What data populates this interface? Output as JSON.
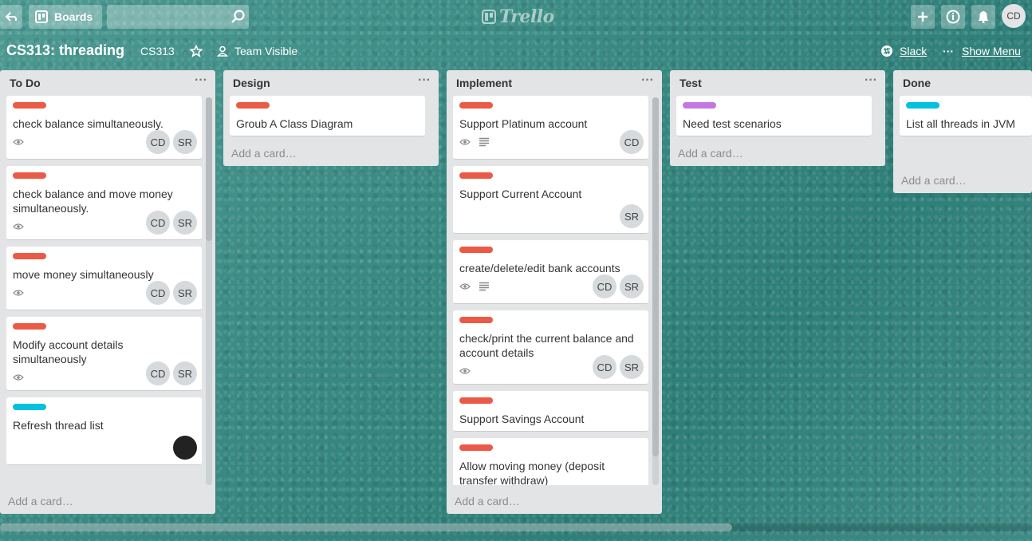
{
  "header": {
    "boards_label": "Boards",
    "logo_text": "Trello",
    "user_initials": "CD"
  },
  "board": {
    "title": "CS313: threading",
    "team": "CS313",
    "visibility": "Team Visible",
    "slack_label": "Slack",
    "show_menu_label": "Show Menu"
  },
  "colors": {
    "red_label": "#eb5a46",
    "teal_label": "#00c2e0",
    "purple_label": "#c377e0"
  },
  "add_card_label": "Add a card…",
  "lists": [
    {
      "title": "To Do",
      "cards": [
        {
          "title": "check balance simultaneously.",
          "label": "#eb5a46",
          "watch": true,
          "desc": false,
          "members": [
            "CD",
            "SR"
          ]
        },
        {
          "title": "check balance and move money simultaneously.",
          "label": "#eb5a46",
          "watch": true,
          "desc": false,
          "members": [
            "CD",
            "SR"
          ]
        },
        {
          "title": "move money simultaneously",
          "label": "#eb5a46",
          "watch": true,
          "desc": false,
          "members": [
            "CD",
            "SR"
          ]
        },
        {
          "title": "Modify account details simultaneously",
          "label": "#eb5a46",
          "watch": true,
          "desc": false,
          "members": [
            "CD",
            "SR"
          ]
        },
        {
          "title": "Refresh thread list",
          "label": "#00c2e0",
          "watch": false,
          "desc": false,
          "members": [
            ""
          ]
        }
      ]
    },
    {
      "title": "Design",
      "cards": [
        {
          "title": "Groub A Class Diagram",
          "label": "#eb5a46",
          "watch": false,
          "desc": false,
          "members": []
        }
      ]
    },
    {
      "title": "Implement",
      "cards": [
        {
          "title": "Support Platinum account",
          "label": "#eb5a46",
          "watch": true,
          "desc": true,
          "members": [
            "CD"
          ]
        },
        {
          "title": "Support Current Account",
          "label": "#eb5a46",
          "watch": false,
          "desc": false,
          "members": [
            "SR"
          ]
        },
        {
          "title": "create/delete/edit bank accounts",
          "label": "#eb5a46",
          "watch": true,
          "desc": true,
          "members": [
            "CD",
            "SR"
          ]
        },
        {
          "title": "check/print the current balance and account details",
          "label": "#eb5a46",
          "watch": true,
          "desc": false,
          "members": [
            "CD",
            "SR"
          ]
        },
        {
          "title": "Support Savings Account",
          "label": "#eb5a46",
          "watch": false,
          "desc": false,
          "members": []
        },
        {
          "title": "Allow moving money (deposit transfer withdraw)",
          "label": "#eb5a46",
          "watch": false,
          "desc": false,
          "members": []
        }
      ]
    },
    {
      "title": "Test",
      "cards": [
        {
          "title": "Need test scenarios",
          "label": "#c377e0",
          "watch": false,
          "desc": false,
          "members": []
        }
      ]
    },
    {
      "title": "Done",
      "cards": [
        {
          "title": "List all threads in JVM",
          "label": "#00c2e0",
          "watch": false,
          "desc": false,
          "members": []
        }
      ]
    }
  ]
}
